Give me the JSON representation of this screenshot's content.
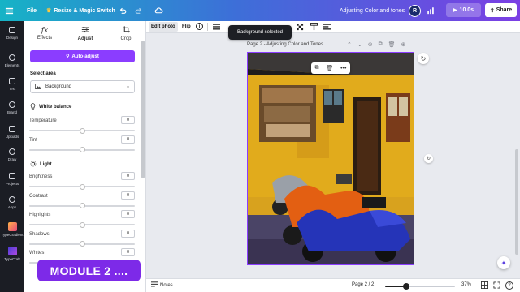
{
  "topbar": {
    "file_label": "File",
    "resize_label": "Resize & Magic Switch",
    "doc_title": "Adjusting Color and tones",
    "avatar_initial": "R",
    "timer_label": "10.0s",
    "share_label": "Share"
  },
  "rail": [
    {
      "label": "Design",
      "icon": "layout-icon"
    },
    {
      "label": "Elements",
      "icon": "shapes-icon"
    },
    {
      "label": "Text",
      "icon": "text-icon"
    },
    {
      "label": "Brand",
      "icon": "brand-icon"
    },
    {
      "label": "Uploads",
      "icon": "upload-icon"
    },
    {
      "label": "Draw",
      "icon": "draw-icon"
    },
    {
      "label": "Projects",
      "icon": "folder-icon"
    },
    {
      "label": "Apps",
      "icon": "apps-icon"
    },
    {
      "label": "TypeGradient",
      "icon": "typegradient-icon"
    },
    {
      "label": "TypeCraft",
      "icon": "typecraft-icon"
    }
  ],
  "panel": {
    "tabs": [
      {
        "label": "Effects",
        "icon": "fx-icon"
      },
      {
        "label": "Adjust",
        "icon": "sliders-icon"
      },
      {
        "label": "Crop",
        "icon": "crop-icon"
      }
    ],
    "active_tab": "Adjust",
    "auto_adjust_label": "Auto-adjust",
    "select_area_label": "Select area",
    "select_area_value": "Background",
    "white_balance": {
      "title": "White balance",
      "sliders": [
        {
          "label": "Temperature",
          "value": 0,
          "level": 0.5
        },
        {
          "label": "Tint",
          "value": 0,
          "level": 0.5
        }
      ]
    },
    "light": {
      "title": "Light",
      "sliders": [
        {
          "label": "Brightness",
          "value": 0,
          "level": 0.5
        },
        {
          "label": "Contrast",
          "value": 0,
          "level": 0.5
        },
        {
          "label": "Highlights",
          "value": 0,
          "level": 0.5
        },
        {
          "label": "Shadows",
          "value": 0,
          "level": 0.5
        },
        {
          "label": "Whites",
          "value": 0,
          "level": 0.5
        }
      ]
    }
  },
  "module_banner": "MODULE 2 ....",
  "toolbar": {
    "edit_photo_label": "Edit photo",
    "flip_label": "Flip",
    "toast": "Background selected"
  },
  "canvas": {
    "page_label": "Page 2 - Adjusting Color and Tones"
  },
  "bottombar": {
    "notes_label": "Notes",
    "page_indicator": "Page 2 / 2",
    "zoom_label": "37%",
    "zoom_level": 0.3
  },
  "colors": {
    "accent": "#8b3dff",
    "topbar_start": "#16b3c6",
    "topbar_end": "#7b3fe4",
    "rail_bg": "#1b1d24",
    "banner_bg": "#7d2ae8"
  }
}
